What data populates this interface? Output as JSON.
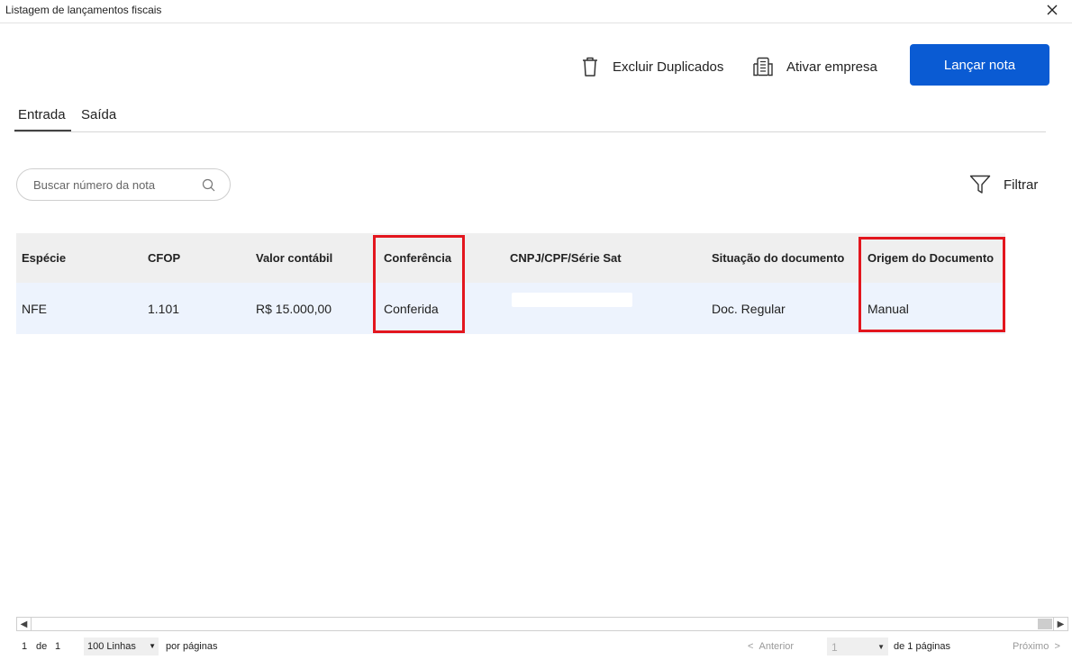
{
  "window": {
    "title": "Listagem de lançamentos fiscais",
    "close_icon": "close-icon"
  },
  "toolbar": {
    "excluir_label": "Excluir Duplicados",
    "excluir_icon": "trash-icon",
    "ativar_label": "Ativar empresa",
    "ativar_icon": "building-icon",
    "lancar_label": "Lançar nota",
    "accent_color": "#0a5bd3"
  },
  "tabs": [
    {
      "label": "Entrada",
      "active": true
    },
    {
      "label": "Saída",
      "active": false
    }
  ],
  "search": {
    "placeholder": "Buscar número da nota",
    "icon": "search-icon"
  },
  "filter": {
    "label": "Filtrar",
    "icon": "filter-icon"
  },
  "table": {
    "columns": [
      "Espécie",
      "CFOP",
      "Valor contábil",
      "Conferência",
      "CNPJ/CPF/Série Sat",
      "Situação do documento",
      "Origem do Documento"
    ],
    "rows": [
      [
        "NFE",
        "1.101",
        "R$ 15.000,00",
        "Conferida",
        "",
        "Doc. Regular",
        "Manual"
      ]
    ],
    "highlight_color": "#e3161e"
  },
  "pagination": {
    "current": "1",
    "de": "de",
    "total": "1",
    "lines_option": "100 Linhas",
    "por_paginas": "por páginas",
    "prev_label": "Anterior",
    "page_value": "1",
    "de_pages": "de 1 páginas",
    "next_label": "Próximo"
  }
}
